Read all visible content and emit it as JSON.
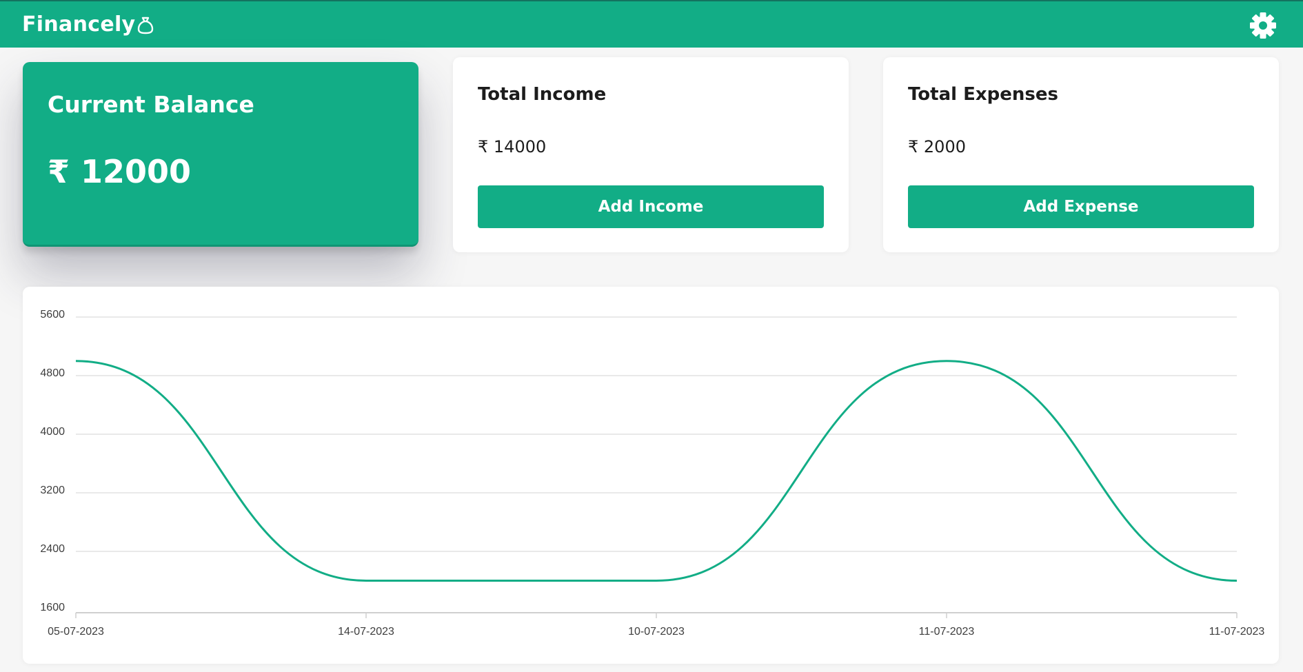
{
  "app": {
    "brand": "Financely",
    "icons": {
      "brand": "money-bag-icon",
      "settings": "gear-icon"
    },
    "colors": {
      "accent": "#12ad86",
      "text": "#1c1c1c",
      "background": "#f6f6f6"
    }
  },
  "balance": {
    "title": "Current Balance",
    "value": "₹ 12000"
  },
  "income": {
    "title": "Total Income",
    "value": "₹ 14000",
    "button_label": "Add Income"
  },
  "expenses": {
    "title": "Total Expenses",
    "value": "₹ 2000",
    "button_label": "Add Expense"
  },
  "chart_data": {
    "type": "line",
    "title": "",
    "xlabel": "",
    "ylabel": "",
    "categories": [
      "05-07-2023",
      "14-07-2023",
      "10-07-2023",
      "11-07-2023",
      "11-07-2023"
    ],
    "values": [
      5000,
      2000,
      2000,
      5000,
      2000
    ],
    "ylim": [
      1600,
      5600
    ],
    "yticks": [
      1600,
      2400,
      3200,
      4000,
      4800,
      5600
    ],
    "grid": true,
    "legend": "none",
    "curve": "smooth",
    "color": "#12ad86"
  }
}
